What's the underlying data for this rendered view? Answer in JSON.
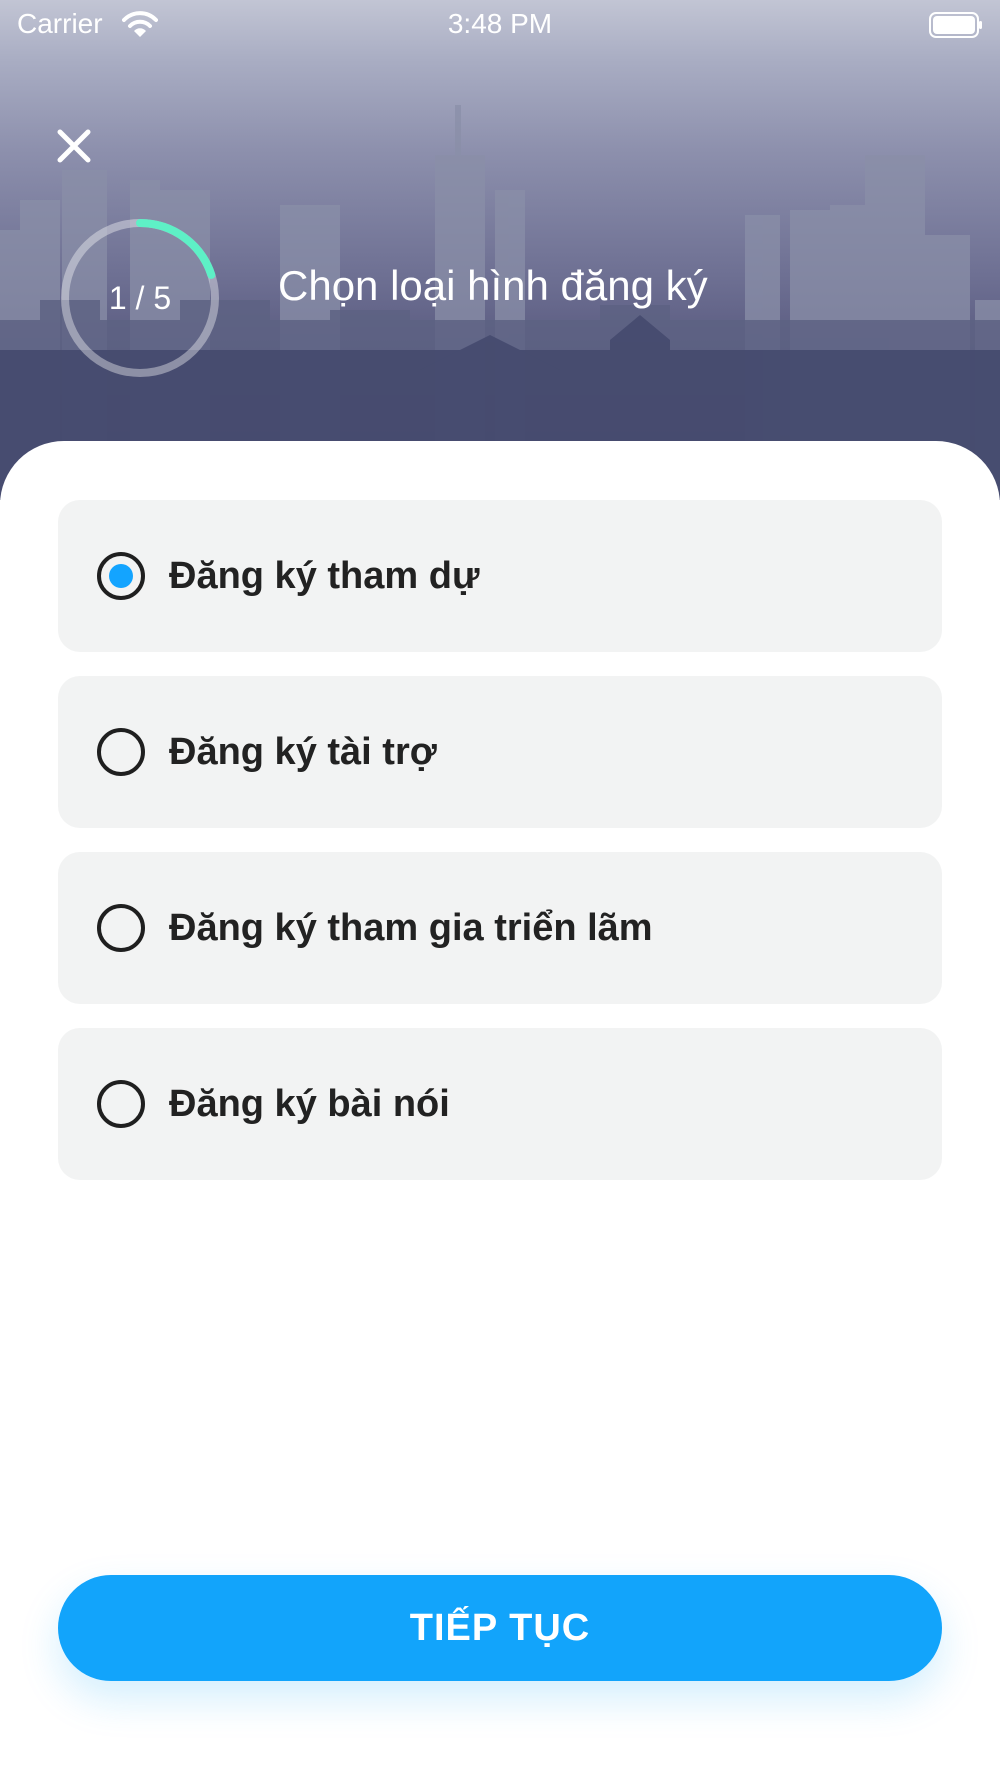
{
  "status_bar": {
    "carrier": "Carrier",
    "time": "3:48 PM"
  },
  "header": {
    "progress_text": "1 / 5",
    "progress_fraction": 0.2,
    "title": "Chọn loại hình đăng ký",
    "close_icon": "close-icon"
  },
  "options": [
    {
      "label": "Đăng ký tham dự",
      "selected": true
    },
    {
      "label": "Đăng ký tài trợ",
      "selected": false
    },
    {
      "label": "Đăng ký tham gia triển lãm",
      "selected": false
    },
    {
      "label": "Đăng ký bài nói",
      "selected": false
    }
  ],
  "continue_button": {
    "label": "TIẾP TỤC"
  },
  "colors": {
    "accent": "#12a4fb",
    "progress_arc": "#5ef0c6",
    "option_background": "#f2f3f3"
  }
}
